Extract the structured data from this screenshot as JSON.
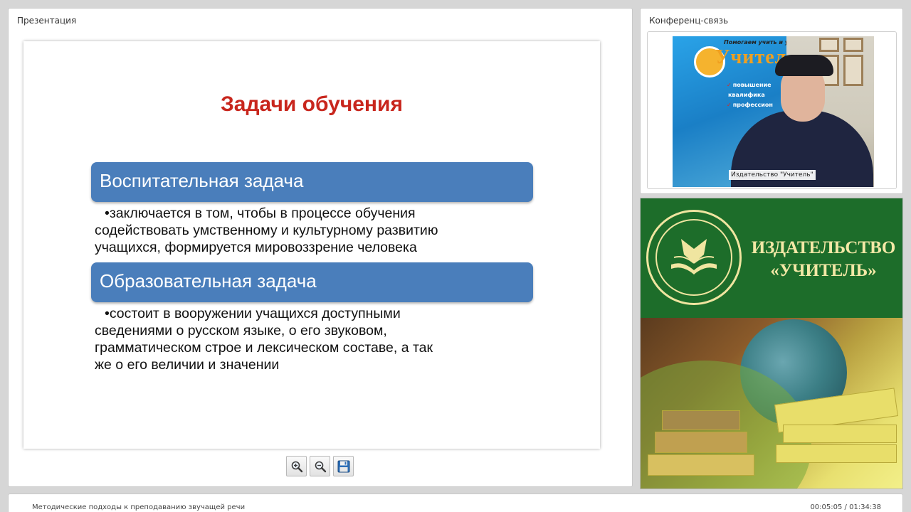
{
  "presentation": {
    "panel_title": "Презентация",
    "slide": {
      "title": "Задачи обучения",
      "tasks": [
        {
          "heading": "Воспитательная задача",
          "lines": [
            "•заключается в том, чтобы в процессе обучения",
            "содействовать умственному и культурному развитию",
            "учащихся,  формируется мировоззрение человека"
          ]
        },
        {
          "heading": "Образовательная задача",
          "lines": [
            "•состоит в вооружении учащихся доступными",
            "сведениями о русском языке, о его звуковом,",
            "грамматическом строе и лексическом составе, а так",
            "же о его величии и значении"
          ]
        }
      ]
    },
    "toolbar": {
      "zoom_in_icon": "zoom-in-icon",
      "zoom_out_icon": "zoom-out-icon",
      "save_icon": "floppy-disk-icon"
    }
  },
  "conference": {
    "panel_title": "Конференц-связь",
    "video_caption": "Издательство \"Учитель\"",
    "poster": {
      "slogan": "Помогаем учить и учиться",
      "brand": "Учител",
      "lines": [
        "повышение",
        "квалифика",
        "профессион"
      ]
    }
  },
  "publisher_banner": {
    "name_line1": "ИЗДАТЕЛЬСТВО",
    "name_line2": "«УЧИТЕЛЬ»",
    "colors": {
      "background": "#1d6d2a",
      "text": "#f3e8a6"
    }
  },
  "bottom_bar": {
    "lecture_title": "Методические подходы к преподаванию звучащей речи",
    "time": "00:05:05 / 01:34:38"
  },
  "colors": {
    "slide_title": "#c8261d",
    "task_bar": "#4a7ebb"
  }
}
